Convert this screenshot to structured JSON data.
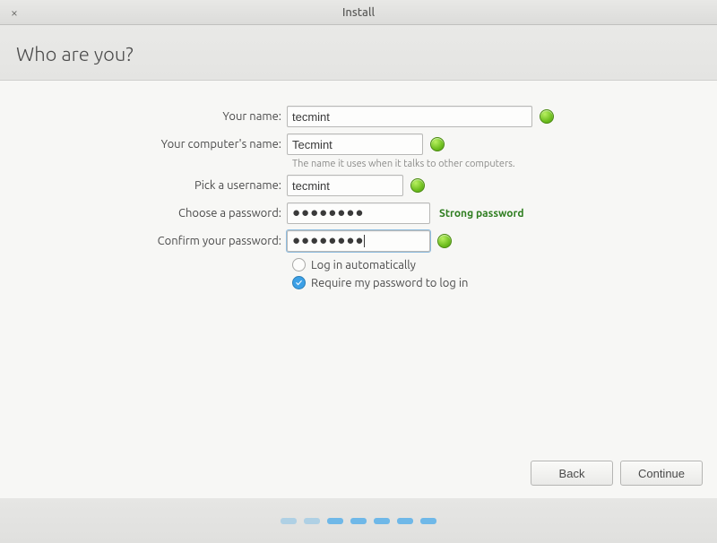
{
  "window": {
    "title": "Install"
  },
  "page": {
    "title": "Who are you?"
  },
  "form": {
    "name": {
      "label": "Your name:",
      "value": "tecmint"
    },
    "computer": {
      "label": "Your computer's name:",
      "value": "Tecmint",
      "help": "The name it uses when it talks to other computers."
    },
    "username": {
      "label": "Pick a username:",
      "value": "tecmint"
    },
    "password": {
      "label": "Choose a password:",
      "mask": "●●●●●●●●",
      "strength": "Strong password"
    },
    "confirm": {
      "label": "Confirm your password:",
      "mask": "●●●●●●●●"
    },
    "login_options": {
      "auto": "Log in automatically",
      "require": "Require my password to log in",
      "selected": "require"
    }
  },
  "buttons": {
    "back": "Back",
    "continue": "Continue"
  }
}
